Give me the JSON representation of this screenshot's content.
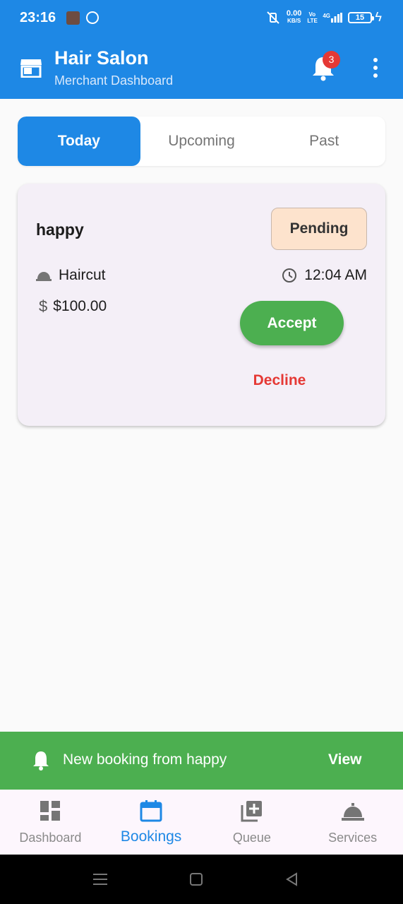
{
  "status_bar": {
    "time": "23:16",
    "net_speed_value": "0.00",
    "net_speed_unit": "KB/S",
    "volte": "Vo LTE",
    "network": "4G",
    "battery": "15",
    "icons": [
      "photo-thumbnail",
      "check-circle-icon",
      "mute-vibrate-icon",
      "signal-icon",
      "battery-icon",
      "charging-bolt-icon"
    ]
  },
  "header": {
    "title": "Hair Salon",
    "subtitle": "Merchant Dashboard",
    "notification_count": "3",
    "icons": [
      "store-icon",
      "bell-icon",
      "more-vert-icon"
    ]
  },
  "tabs": [
    {
      "label": "Today",
      "active": true
    },
    {
      "label": "Upcoming",
      "active": false
    },
    {
      "label": "Past",
      "active": false
    }
  ],
  "booking": {
    "customer": "happy",
    "status": "Pending",
    "service": "Haircut",
    "time": "12:04 AM",
    "price": "$100.00",
    "accept_label": "Accept",
    "decline_label": "Decline"
  },
  "snackbar": {
    "message": "New booking from happy",
    "action": "View"
  },
  "bottom_nav": [
    {
      "label": "Dashboard",
      "icon": "dashboard-icon",
      "active": false
    },
    {
      "label": "Bookings",
      "icon": "calendar-icon",
      "active": true
    },
    {
      "label": "Queue",
      "icon": "queue-add-icon",
      "active": false
    },
    {
      "label": "Services",
      "icon": "room-service-icon",
      "active": false
    }
  ],
  "colors": {
    "primary": "#1e88e5",
    "accept": "#4caf50",
    "decline": "#e53935",
    "pending_bg": "#fde3cd",
    "card_bg": "#f4eff7",
    "badge": "#e53935"
  }
}
